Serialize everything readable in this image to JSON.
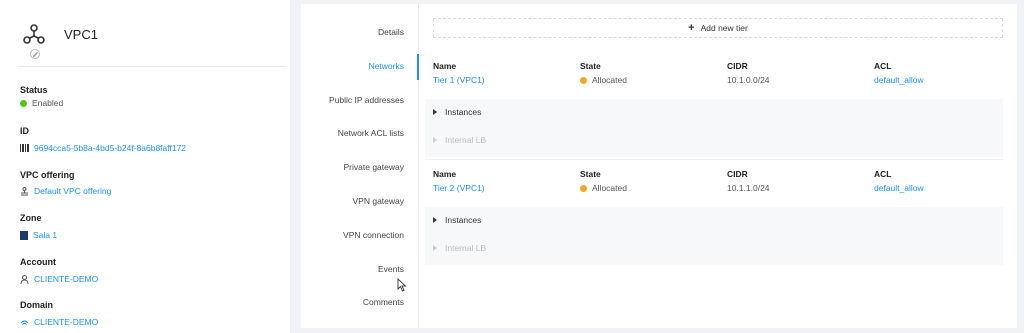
{
  "vpc": {
    "name": "VPC1"
  },
  "details": {
    "status": {
      "label": "Status",
      "value": "Enabled",
      "color": "#52c41a"
    },
    "id": {
      "label": "ID",
      "value": "9694cca5-5b8a-4bd5-b24f-8a6b8faff172"
    },
    "vpc_offering": {
      "label": "VPC offering",
      "value": "Default VPC offering"
    },
    "zone": {
      "label": "Zone",
      "value": "Sala 1"
    },
    "account": {
      "label": "Account",
      "value": "CLIENTE-DEMO"
    },
    "domain": {
      "label": "Domain",
      "value": "CLIENTE-DEMO"
    }
  },
  "tabs": [
    "Details",
    "Networks",
    "Public IP addresses",
    "Network ACL lists",
    "Private gateway",
    "VPN gateway",
    "VPN connection",
    "Events",
    "Comments"
  ],
  "active_tab": "Networks",
  "add_tier_label": "Add new tier",
  "columns": {
    "name": "Name",
    "state": "State",
    "cidr": "CIDR",
    "acl": "ACL"
  },
  "tiers": [
    {
      "name": "Tier 1 (VPC1)",
      "state": "Allocated",
      "cidr": "10.1.0.0/24",
      "acl": "default_allow"
    },
    {
      "name": "Tier 2 (VPC1)",
      "state": "Allocated",
      "cidr": "10.1.1.0/24",
      "acl": "default_allow"
    }
  ],
  "sub_sections": {
    "instances": "Instances",
    "internal_lb": "Internal LB"
  },
  "colors": {
    "accent": "#1890ff",
    "allocated": "#f5a623"
  }
}
